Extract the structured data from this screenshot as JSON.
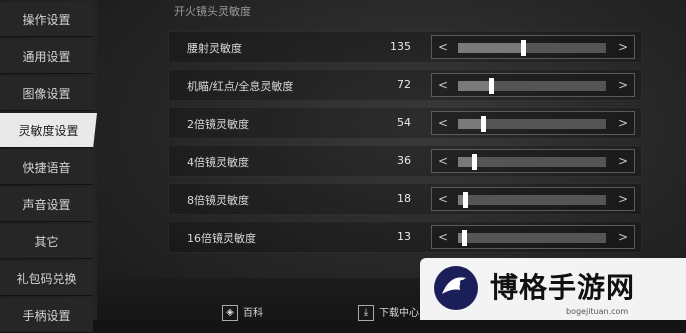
{
  "sidebar": {
    "items": [
      {
        "label": "操作设置",
        "active": false
      },
      {
        "label": "通用设置",
        "active": false
      },
      {
        "label": "图像设置",
        "active": false
      },
      {
        "label": "灵敏度设置",
        "active": true
      },
      {
        "label": "快捷语音",
        "active": false
      },
      {
        "label": "声音设置",
        "active": false
      },
      {
        "label": "其它",
        "active": false
      },
      {
        "label": "礼包码兑换",
        "active": false
      },
      {
        "label": "手柄设置",
        "active": false
      }
    ]
  },
  "section": {
    "title": "开火镜头灵敏度"
  },
  "sliders": [
    {
      "label": "腰射灵敏度",
      "value": "135",
      "level": 0.44
    },
    {
      "label": "机瞄/红点/全息灵敏度",
      "value": "72",
      "level": 0.22
    },
    {
      "label": "2倍镜灵敏度",
      "value": "54",
      "level": 0.17
    },
    {
      "label": "4倍镜灵敏度",
      "value": "36",
      "level": 0.11
    },
    {
      "label": "8倍镜灵敏度",
      "value": "18",
      "level": 0.05
    },
    {
      "label": "16倍镜灵敏度",
      "value": "13",
      "level": 0.04
    }
  ],
  "stepper": {
    "left_icon": "chevron-left-icon",
    "right_icon": "chevron-right-icon"
  },
  "bottom_bar": {
    "wiki_label": "百科",
    "download_label": "下载中心"
  },
  "watermark": {
    "title": "博格手游网",
    "url": "bogejituan.com"
  },
  "colors": {
    "active_tab_bg": "#e9e9e9",
    "thumb": "#ffffff",
    "track": "#555555"
  }
}
